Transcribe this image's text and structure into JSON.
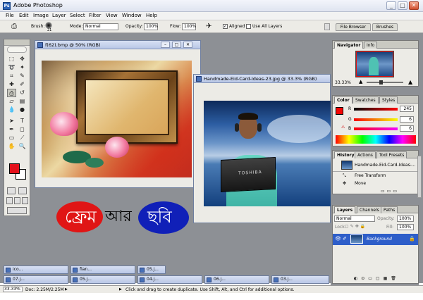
{
  "window": {
    "title": "Adobe Photoshop"
  },
  "menu": [
    "File",
    "Edit",
    "Image",
    "Layer",
    "Select",
    "Filter",
    "View",
    "Window",
    "Help"
  ],
  "options": {
    "brush_label": "Brush:",
    "brush_size": "21",
    "mode_label": "Mode:",
    "mode_value": "Normal",
    "opacity_label": "Opacity:",
    "opacity_value": "100%",
    "flow_label": "Flow:",
    "flow_value": "100%",
    "aligned_label": "Aligned",
    "use_all_layers_label": "Use All Layers",
    "file_browser_tab": "File Browser",
    "brushes_tab": "Brushes"
  },
  "documents": [
    {
      "title": "f(62).bmp @ 50% (RGB)"
    },
    {
      "title": "Handmade-Eid-Card-Ideas-23.jpg @ 33.3% (RGB)",
      "laptop_brand": "TOSHIBA"
    }
  ],
  "banner": {
    "word1": "ফ্রেম",
    "word2": "আর",
    "word3": "ছবি"
  },
  "navigator": {
    "tabs": [
      "Navigator",
      "Info"
    ],
    "zoom": "33.33%"
  },
  "color": {
    "tabs": [
      "Color",
      "Swatches",
      "Styles"
    ],
    "r_label": "R",
    "r_value": "245",
    "g_label": "G",
    "g_value": "6",
    "b_label": "B",
    "b_value": "6",
    "fg_color": "#f50606"
  },
  "history": {
    "tabs": [
      "History",
      "Actions",
      "Tool Presets"
    ],
    "snapshot": "Handmade-Eid-Card-Ideas-...",
    "steps": [
      "Free Transform",
      "Move"
    ]
  },
  "layers": {
    "tabs": [
      "Layers",
      "Channels",
      "Paths"
    ],
    "blend_mode": "Normal",
    "opacity_label": "Opacity:",
    "opacity_value": "100%",
    "lock_label": "Lock:",
    "fill_label": "Fill:",
    "fill_value": "100%",
    "layer_name": "Background"
  },
  "minimized": [
    "ico...",
    "fian...",
    "07.j...",
    "05.j...",
    "04.j...",
    "06.j...",
    "03.j...",
    "05.j..."
  ],
  "status": {
    "zoom": "33.33%",
    "doc": "Doc: 2.25M/2.25M",
    "hint": "Click and drag to create duplicate.  Use Shift, Alt, and Ctrl for additional options."
  }
}
